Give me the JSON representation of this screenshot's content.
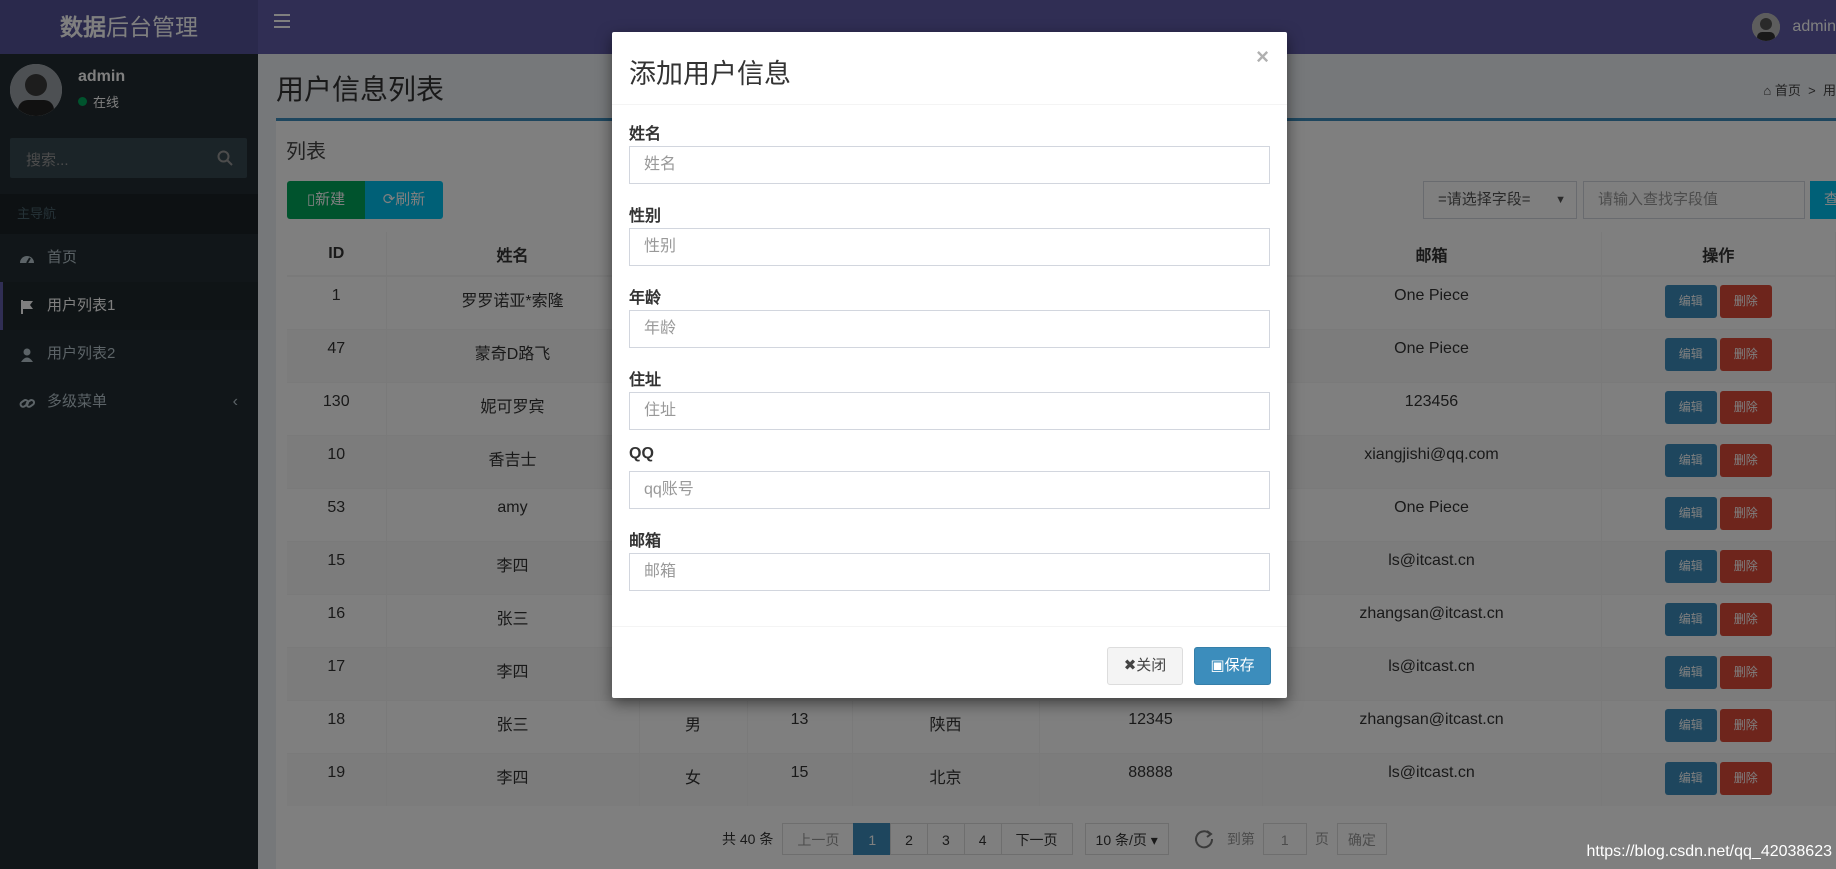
{
  "header": {
    "logo_bold": "数据",
    "logo_rest": "后台管理",
    "user_name": "admin"
  },
  "sidebar": {
    "user_name": "admin",
    "status": "在线",
    "search_placeholder": "搜索...",
    "section_header": "主导航",
    "items": [
      {
        "label": "首页",
        "icon": "dashboard-icon"
      },
      {
        "label": "用户列表1",
        "icon": "flag-icon",
        "active": true
      },
      {
        "label": "用户列表2",
        "icon": "user-icon"
      },
      {
        "label": "多级菜单",
        "icon": "link-icon",
        "has_children": true
      }
    ]
  },
  "page": {
    "title": "用户信息列表",
    "breadcrumb_home": "首页",
    "breadcrumb_next": "用"
  },
  "box": {
    "title": "列表",
    "new_label": "新建",
    "refresh_label": "刷新",
    "field_select": "=请选择字段=",
    "search_placeholder": "请输入查找字段值",
    "query_label": "查"
  },
  "table": {
    "headers": [
      "ID",
      "姓名",
      "",
      "",
      "",
      "",
      "邮箱",
      "操作"
    ],
    "edit_label": "编辑",
    "delete_label": "删除",
    "rows": [
      [
        "1",
        "罗罗诺亚*索隆",
        "",
        "",
        "",
        "",
        "One Piece"
      ],
      [
        "47",
        "蒙奇D路飞",
        "",
        "",
        "",
        "",
        "One Piece"
      ],
      [
        "130",
        "妮可罗宾",
        "",
        "",
        "",
        "",
        "123456"
      ],
      [
        "10",
        "香吉士",
        "",
        "",
        "",
        "",
        "xiangjishi@qq.com"
      ],
      [
        "53",
        "amy",
        "",
        "",
        "",
        "",
        "One Piece"
      ],
      [
        "15",
        "李四",
        "",
        "",
        "",
        "",
        "ls@itcast.cn"
      ],
      [
        "16",
        "张三",
        "",
        "",
        "",
        "",
        "zhangsan@itcast.cn"
      ],
      [
        "17",
        "李四",
        "",
        "",
        "",
        "",
        "ls@itcast.cn"
      ],
      [
        "18",
        "张三",
        "男",
        "13",
        "陕西",
        "12345",
        "zhangsan@itcast.cn"
      ],
      [
        "19",
        "李四",
        "女",
        "15",
        "北京",
        "88888",
        "ls@itcast.cn"
      ]
    ]
  },
  "pager": {
    "total": "共 40 条",
    "prev": "上一页",
    "pages": [
      "1",
      "2",
      "3",
      "4"
    ],
    "current": "1",
    "next": "下一页",
    "page_size": "10 条/页",
    "goto_label": "到第",
    "goto_value": "1",
    "page_unit": "页",
    "confirm": "确定"
  },
  "modal": {
    "title": "添加用户信息",
    "close_symbol": "×",
    "fields": [
      {
        "label": "姓名",
        "placeholder": "姓名"
      },
      {
        "label": "性别",
        "placeholder": "性别"
      },
      {
        "label": "年龄",
        "placeholder": "年龄"
      },
      {
        "label": "住址",
        "placeholder": "住址"
      },
      {
        "label": "QQ",
        "placeholder": "qq账号"
      },
      {
        "label": "邮箱",
        "placeholder": "邮箱"
      }
    ],
    "close_label": "关闭",
    "save_label": "保存"
  },
  "watermark": "https://blog.csdn.net/qq_42038623"
}
